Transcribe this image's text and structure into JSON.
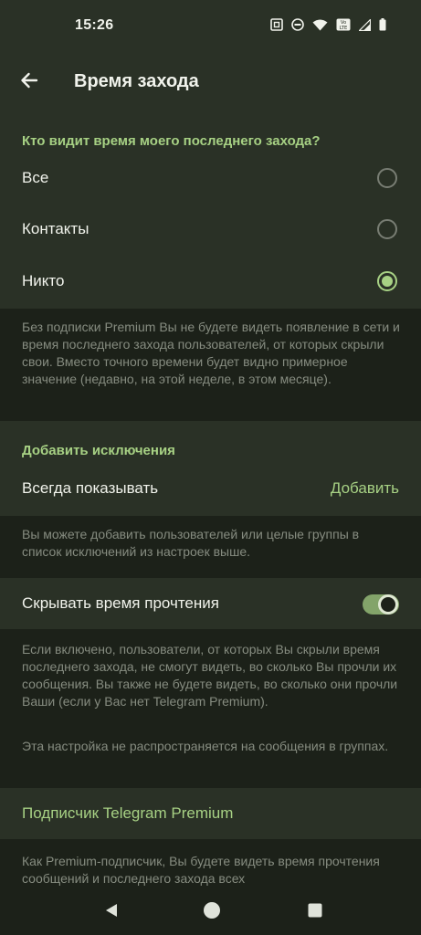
{
  "status_bar": {
    "time": "15:26",
    "icons": [
      "nfc-icon",
      "do-not-disturb-icon",
      "wifi-icon",
      "volte-icon",
      "signal-icon",
      "battery-icon"
    ],
    "volte_label": "Vo LTE"
  },
  "app_bar": {
    "back_icon": "arrow-left-icon",
    "title": "Время захода"
  },
  "visibility": {
    "header": "Кто видит время моего последнего захода?",
    "options": [
      {
        "label": "Все",
        "checked": false
      },
      {
        "label": "Контакты",
        "checked": false
      },
      {
        "label": "Никто",
        "checked": true
      }
    ],
    "info": "Без подписки Premium Вы не будете видеть появление в сети и время последнего захода пользователей, от которых скрыли свои. Вместо точного времени будет видно примерное значение (недавно, на этой неделе, в этом месяце)."
  },
  "exceptions": {
    "header": "Добавить исключения",
    "always_show_label": "Всегда показывать",
    "add_label": "Добавить",
    "info": "Вы можете добавить пользователей или целые группы в список исключений из настроек выше."
  },
  "read_time": {
    "label": "Скрывать время прочтения",
    "enabled": true,
    "info_1": "Если включено, пользователи, от которых Вы скрыли время последнего захода, не смогут видеть, во сколько Вы прочли их сообщения. Вы также не будете видеть, во сколько они прочли Ваши (если у Вас нет Telegram Premium).",
    "info_2": "Эта настройка не распространяется на сообщения в группах."
  },
  "premium": {
    "label": "Подписчик Telegram Premium",
    "info": "Как Premium-подписчик, Вы будете видеть время прочтения сообщений и последнего захода всех"
  },
  "nav_bar": {
    "icons": [
      "back-triangle-icon",
      "home-circle-icon",
      "recents-square-icon"
    ]
  },
  "colors": {
    "accent": "#a7d184",
    "surface": "#2a3126",
    "background": "#1c2119",
    "secondary_text": "#868c80"
  }
}
